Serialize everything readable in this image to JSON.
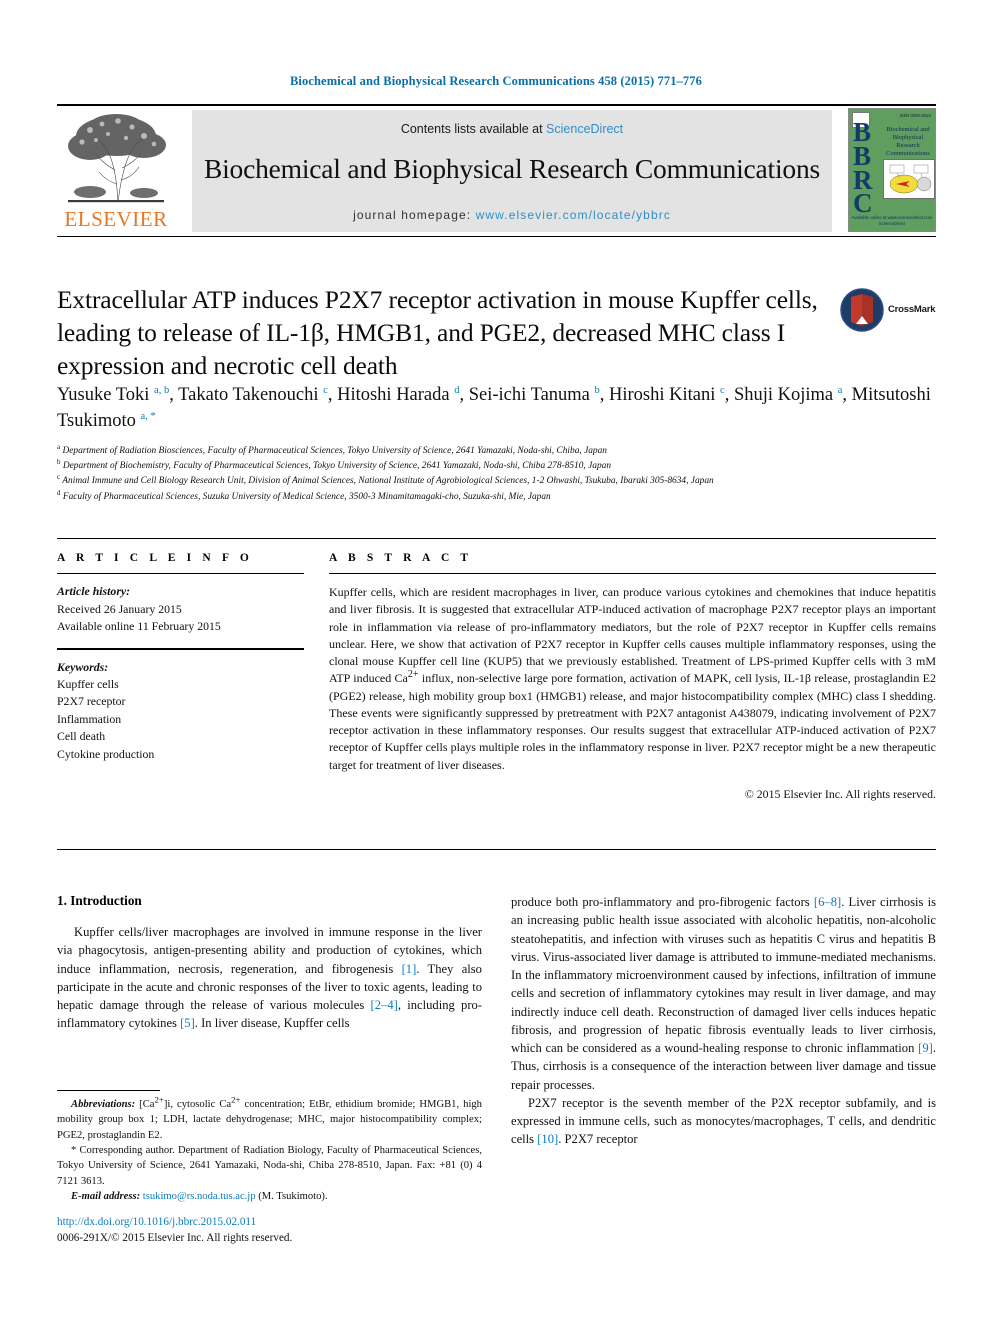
{
  "running_head": "Biochemical and Biophysical Research Communications 458 (2015) 771–776",
  "header": {
    "publisher_name": "ELSEVIER",
    "contents_prefix": "Contents lists available at ",
    "contents_link": "ScienceDirect",
    "journal_title": "Biochemical and Biophysical Research Communications",
    "homepage_prefix": "journal homepage: ",
    "homepage_url": "www.elsevier.com/locate/ybbrc",
    "cover": {
      "letters": "BBRC",
      "title": "Biochemical and Biophysical Research Communications",
      "issn": "ISSN 0006-291X",
      "footer": "Available online at www.sciencedirect.com\nScienceDirect"
    }
  },
  "article": {
    "title": "Extracellular ATP induces P2X7 receptor activation in mouse Kupffer cells, leading to release of IL-1β, HMGB1, and PGE2, decreased MHC class I expression and necrotic cell death",
    "crossmark_label": "CrossMark",
    "authors_line_1": "Yusuke Toki",
    "authors": [
      {
        "name": "Yusuke Toki",
        "marks": "a, b"
      },
      {
        "name": "Takato Takenouchi",
        "marks": "c"
      },
      {
        "name": "Hitoshi Harada",
        "marks": "d"
      },
      {
        "name": "Sei-ichi Tanuma",
        "marks": "b"
      },
      {
        "name": "Hiroshi Kitani",
        "marks": "c"
      },
      {
        "name": "Shuji Kojima",
        "marks": "a"
      },
      {
        "name": "Mitsutoshi Tsukimoto",
        "marks": "a, *"
      }
    ],
    "affiliations": [
      {
        "mark": "a",
        "text": "Department of Radiation Biosciences, Faculty of Pharmaceutical Sciences, Tokyo University of Science, 2641 Yamazaki, Noda-shi, Chiba, Japan"
      },
      {
        "mark": "b",
        "text": "Department of Biochemistry, Faculty of Pharmaceutical Sciences, Tokyo University of Science, 2641 Yamazaki, Noda-shi, Chiba 278-8510, Japan"
      },
      {
        "mark": "c",
        "text": "Animal Immune and Cell Biology Research Unit, Division of Animal Sciences, National Institute of Agrobiological Sciences, 1-2 Ohwashi, Tsukuba, Ibaraki 305-8634, Japan"
      },
      {
        "mark": "d",
        "text": "Faculty of Pharmaceutical Sciences, Suzuka University of Medical Science, 3500-3 Minamitamagaki-cho, Suzuka-shi, Mie, Japan"
      }
    ]
  },
  "article_info": {
    "section_label": "A R T I C L E  I N F O",
    "history_heading": "Article history:",
    "history": [
      "Received 26 January 2015",
      "Available online 11 February 2015"
    ],
    "keywords_heading": "Keywords:",
    "keywords": [
      "Kupffer cells",
      "P2X7 receptor",
      "Inflammation",
      "Cell death",
      "Cytokine production"
    ]
  },
  "abstract": {
    "section_label": "A B S T R A C T",
    "paragraph_part_1": "Kupffer cells, which are resident macrophages in liver, can produce various cytokines and chemokines that induce hepatitis and liver fibrosis. It is suggested that extracellular ATP-induced activation of macrophage P2X7 receptor plays an important role in inflammation via release of pro-inflammatory mediators, but the role of P2X7 receptor in Kupffer cells remains unclear. Here, we show that activation of P2X7 receptor in Kupffer cells causes multiple inflammatory responses, using the clonal mouse Kupffer cell line (KUP5) that we previously established. Treatment of LPS-primed Kupffer cells with 3 mM ATP induced Ca",
    "sup_1": "2+",
    "paragraph_part_2": " influx, non-selective large pore formation, activation of MAPK, cell lysis, IL-1β release, prostaglandin E2 (PGE2) release, high mobility group box1 (HMGB1) release, and major histocompatibility complex (MHC) class I shedding. These events were significantly suppressed by pretreatment with P2X7 antagonist A438079, indicating involvement of P2X7 receptor activation in these inflammatory responses. Our results suggest that extracellular ATP-induced activation of P2X7 receptor of Kupffer cells plays multiple roles in the inflammatory response in liver. P2X7 receptor might be a new therapeutic target for treatment of liver diseases.",
    "copyright": "© 2015 Elsevier Inc. All rights reserved."
  },
  "body": {
    "intro_heading": "1.  Introduction",
    "left_paragraph_1_a": "Kupffer cells/liver macrophages are involved in immune response in the liver via phagocytosis, antigen-presenting ability and production of cytokines, which induce inflammation, necrosis, regeneration, and fibrogenesis ",
    "ref_1": "[1]",
    "left_paragraph_1_b": ". They also participate in the acute and chronic responses of the liver to toxic agents, leading to hepatic damage through the release of various molecules ",
    "ref_2_4": "[2–4]",
    "left_paragraph_1_c": ", including pro-inflammatory cytokines ",
    "ref_5": "[5]",
    "left_paragraph_1_d": ". In liver disease, Kupffer cells",
    "right_paragraph_1_a": "produce both pro-inflammatory and pro-fibrogenic factors ",
    "ref_6_8": "[6–8]",
    "right_paragraph_1_b": ". Liver cirrhosis is an increasing public health issue associated with alcoholic hepatitis, non-alcoholic steatohepatitis, and infection with viruses such as hepatitis C virus and hepatitis B virus. Virus-associated liver damage is attributed to immune-mediated mechanisms. In the inflammatory microenvironment caused by infections, infiltration of immune cells and secretion of inflammatory cytokines may result in liver damage, and may indirectly induce cell death. Reconstruction of damaged liver cells induces hepatic fibrosis, and progression of hepatic fibrosis eventually leads to liver cirrhosis, which can be considered as a wound-healing response to chronic inflammation ",
    "ref_9": "[9]",
    "right_paragraph_1_c": ". Thus, cirrhosis is a consequence of the interaction between liver damage and tissue repair processes.",
    "right_paragraph_2_a": "P2X7 receptor is the seventh member of the P2X receptor subfamily, and is expressed in immune cells, such as monocytes/macrophages, T cells, and dendritic cells ",
    "ref_10": "[10]",
    "right_paragraph_2_b": ". P2X7 receptor"
  },
  "footnotes": {
    "abbrev_label": "Abbreviations:",
    "abbrev_text_a": " [Ca",
    "abbrev_sup_1": "2+",
    "abbrev_text_b": "]i, cytosolic Ca",
    "abbrev_sup_2": "2+",
    "abbrev_text_c": " concentration; EtBr, ethidium bromide; HMGB1, high mobility group box 1; LDH, lactate dehydrogenase; MHC, major histocompatibility complex; PGE2, prostaglandin E2.",
    "corresponding_marker": "*",
    "corresponding_text": " Corresponding author. Department of Radiation Biology, Faculty of Pharmaceutical Sciences, Tokyo University of Science, 2641 Yamazaki, Noda-shi, Chiba 278-8510, Japan. Fax: +81 (0) 4 7121 3613.",
    "email_label": "E-mail address:",
    "email_value": " tsukimo@rs.noda.tus.ac.jp",
    "email_suffix": " (M. Tsukimoto)."
  },
  "footer": {
    "doi": "http://dx.doi.org/10.1016/j.bbrc.2015.02.011",
    "issn_copyright": "0006-291X/© 2015 Elsevier Inc. All rights reserved."
  },
  "colors": {
    "link_blue": "#0b7dba",
    "sciencedirect_blue": "#2f8fc4",
    "elsevier_orange": "#e87722",
    "cover_green": "#5f9e5f",
    "header_gray": "#e3e3e3"
  }
}
